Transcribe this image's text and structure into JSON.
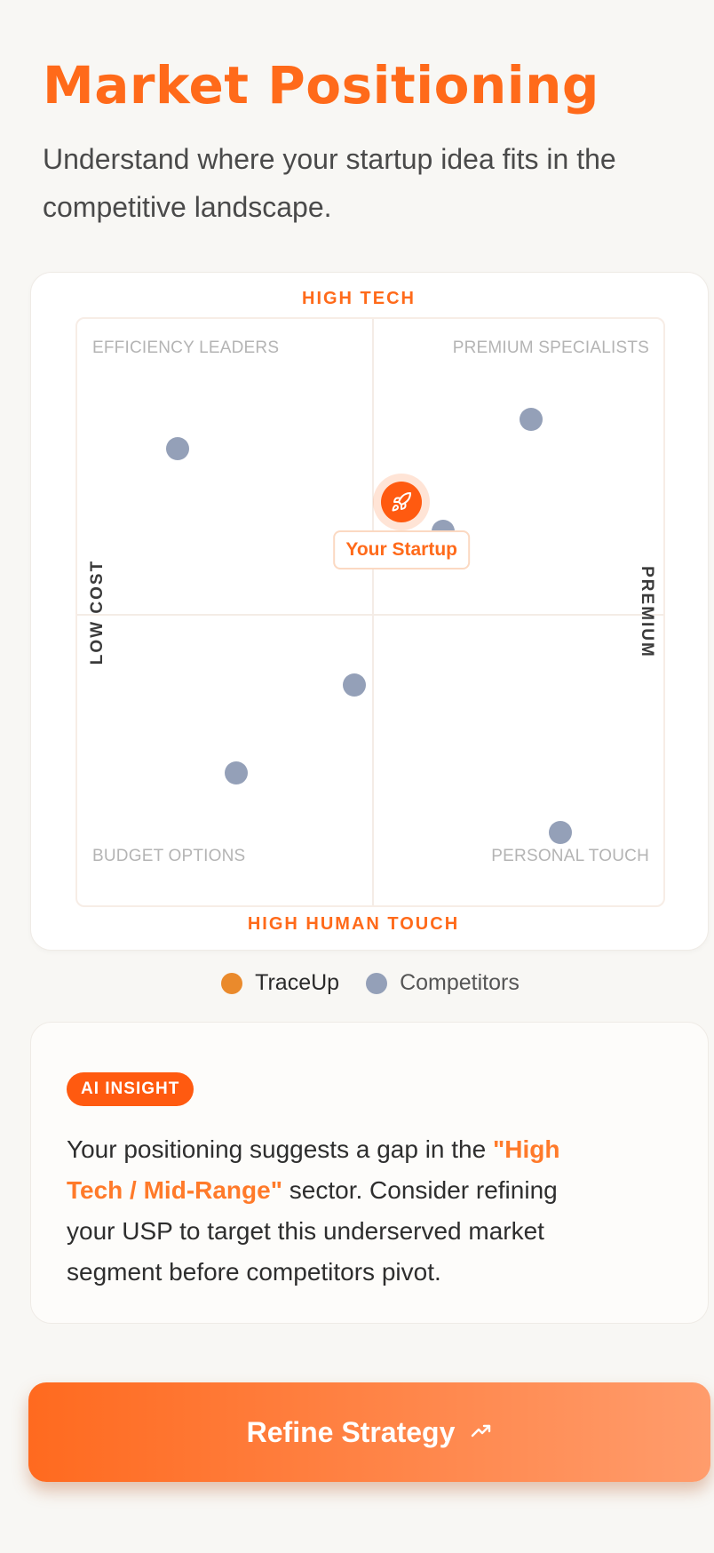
{
  "page": {
    "title": "Market Positioning",
    "subtitle": "Understand where your startup idea fits in the competitive landscape."
  },
  "chart": {
    "axis_top": "HIGH TECH",
    "axis_bottom": "HIGH HUMAN TOUCH",
    "axis_left": "LOW COST",
    "axis_right": "PREMIUM",
    "quadrants": {
      "top_left": "EFFICIENCY LEADERS",
      "top_right": "PREMIUM SPECIALISTS",
      "bottom_left": "BUDGET OPTIONS",
      "bottom_right": "PERSONAL TOUCH"
    },
    "startup_label": "Your Startup",
    "startup_icon": "rocket-icon"
  },
  "chart_data": {
    "type": "scatter",
    "xlabel_left": "LOW COST",
    "xlabel_right": "PREMIUM",
    "ylabel_top": "HIGH TECH",
    "ylabel_bottom": "HIGH HUMAN TOUCH",
    "xlim": [
      0,
      100
    ],
    "ylim": [
      0,
      100
    ],
    "legend_position": "bottom",
    "series": [
      {
        "name": "TraceUp",
        "color": "#ff5a10",
        "points": [
          {
            "x": 55,
            "y": 69
          }
        ]
      },
      {
        "name": "Competitors",
        "color": "#94a0b8",
        "points": [
          {
            "x": 17,
            "y": 78
          },
          {
            "x": 77,
            "y": 83
          },
          {
            "x": 62,
            "y": 64
          },
          {
            "x": 47,
            "y": 38
          },
          {
            "x": 27,
            "y": 23
          },
          {
            "x": 82,
            "y": 13
          }
        ]
      }
    ]
  },
  "legend": {
    "items": [
      {
        "label": "TraceUp",
        "color": "#ff8a2a"
      },
      {
        "label": "Competitors",
        "color": "#94a0b8"
      }
    ]
  },
  "insight": {
    "badge": "AI INSIGHT",
    "text_before": "Your positioning suggests a gap in the ",
    "highlight": "\"High Tech / Mid-Range\"",
    "text_after": " sector. Consider refining your USP to target this underserved market segment before competitors pivot."
  },
  "cta": {
    "label": "Refine Strategy",
    "icon": "trending-up-icon"
  },
  "colors": {
    "accent": "#ff6a1a",
    "competitor": "#94a0b8",
    "background": "#f8f7f4"
  }
}
